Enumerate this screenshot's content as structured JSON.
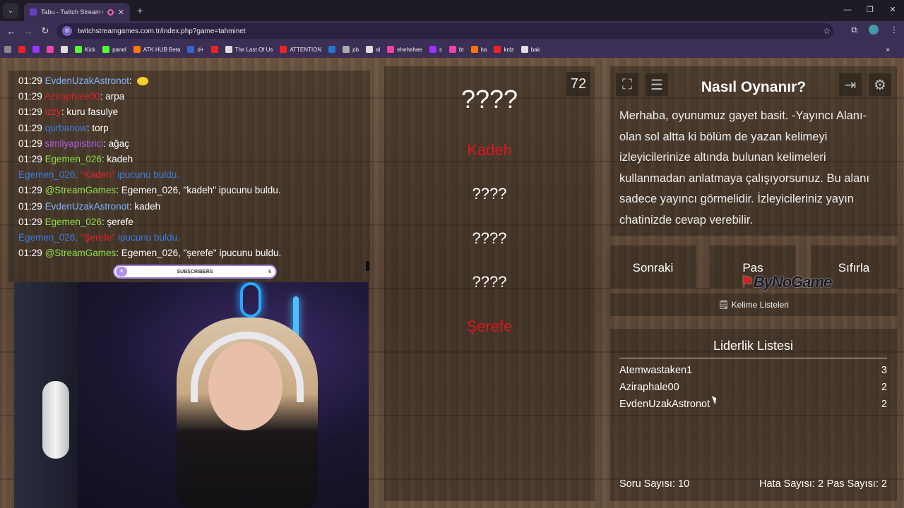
{
  "browser": {
    "tab_title": "Tabu - Twitch Stream Game",
    "url": "twitchstreamgames.com.tr/index.php?game=tahminet",
    "bookmarks": [
      "Kick",
      "panel",
      "ATK HUB Beta",
      "d+",
      "The Last Of Us",
      "ATTENTION",
      "pb",
      "al",
      "ehehehee",
      "s",
      "bt",
      "ha",
      "knlz",
      "bak"
    ]
  },
  "chat": {
    "lines": [
      {
        "ts": "01:29",
        "user": "EvdenUzakAstronot",
        "color": "lblue",
        "msg": ": ",
        "emote": true
      },
      {
        "ts": "01:29",
        "user": "Aziraphale00",
        "color": "red",
        "msg": ": arpa"
      },
      {
        "ts": "01:29",
        "user": "izzy",
        "color": "red",
        "msg": ": kuru fasulye"
      },
      {
        "ts": "01:29",
        "user": "qurbanow",
        "color": "blue",
        "msg": ": torp"
      },
      {
        "ts": "01:29",
        "user": "simliyapistirici",
        "color": "purple",
        "msg": ": ağaç"
      },
      {
        "ts": "01:29",
        "user": "Egemen_026",
        "color": "green",
        "msg": ": kadeh"
      },
      {
        "sys": true,
        "user": "Egemen_026, ",
        "word": "\"Kadeh\"",
        "rest": " ipucunu buldu."
      },
      {
        "ts": "01:29",
        "user": "@StreamGames",
        "color": "green",
        "msg": ": Egemen_026, \"kadeh\" ipucunu buldu."
      },
      {
        "ts": "01:29",
        "user": "EvdenUzakAstronot",
        "color": "lblue",
        "msg": ": kadeh"
      },
      {
        "ts": "01:29",
        "user": "Egemen_026",
        "color": "green",
        "msg": ": şerefe"
      },
      {
        "sys": true,
        "user": "Egemen_026, ",
        "word": "\"Şerefe\"",
        "rest": " ipucunu buldu."
      },
      {
        "ts": "01:29",
        "user": "@StreamGames",
        "color": "green",
        "msg": ": Egemen_026, \"şerefe\" ipucunu buldu."
      }
    ],
    "sub_label": "SUBSCRIBERS",
    "sub_count": "6",
    "sub_current": "0"
  },
  "game": {
    "timer": "72",
    "main_word": "????",
    "hints": [
      "Kadeh",
      "????",
      "????",
      "????",
      "Şerefe"
    ],
    "hints_found": [
      true,
      false,
      false,
      false,
      true
    ]
  },
  "info": {
    "title": "Nasıl Oynanır?",
    "text": "Merhaba, oyunumuz gayet basit. -Yayıncı Alanı- olan sol altta ki bölüm de yazan kelimeyi izleyicilerinize altında bulunan kelimeleri kullanmadan anlatmaya çalışıyorsunuz. Bu alanı sadece yayıncı görmelidir. İzleyicileriniz yayın chatinizde cevap verebilir."
  },
  "buttons": {
    "next": "Sonraki",
    "pass": "Pas",
    "reset": "Sıfırla"
  },
  "overlay_logo": "ByNoGame",
  "word_lists": "Kelime Listeleri",
  "leaderboard": {
    "title": "Liderlik Listesi",
    "rows": [
      {
        "name": "Atemwastaken1",
        "score": "3"
      },
      {
        "name": "Aziraphale00",
        "score": "2"
      },
      {
        "name": "EvdenUzakAstronot",
        "score": "2"
      }
    ]
  },
  "stats": {
    "questions": "Soru Sayısı: 10",
    "errors": "Hata Sayısı: 2",
    "passes": "Pas Sayısı: 2"
  }
}
